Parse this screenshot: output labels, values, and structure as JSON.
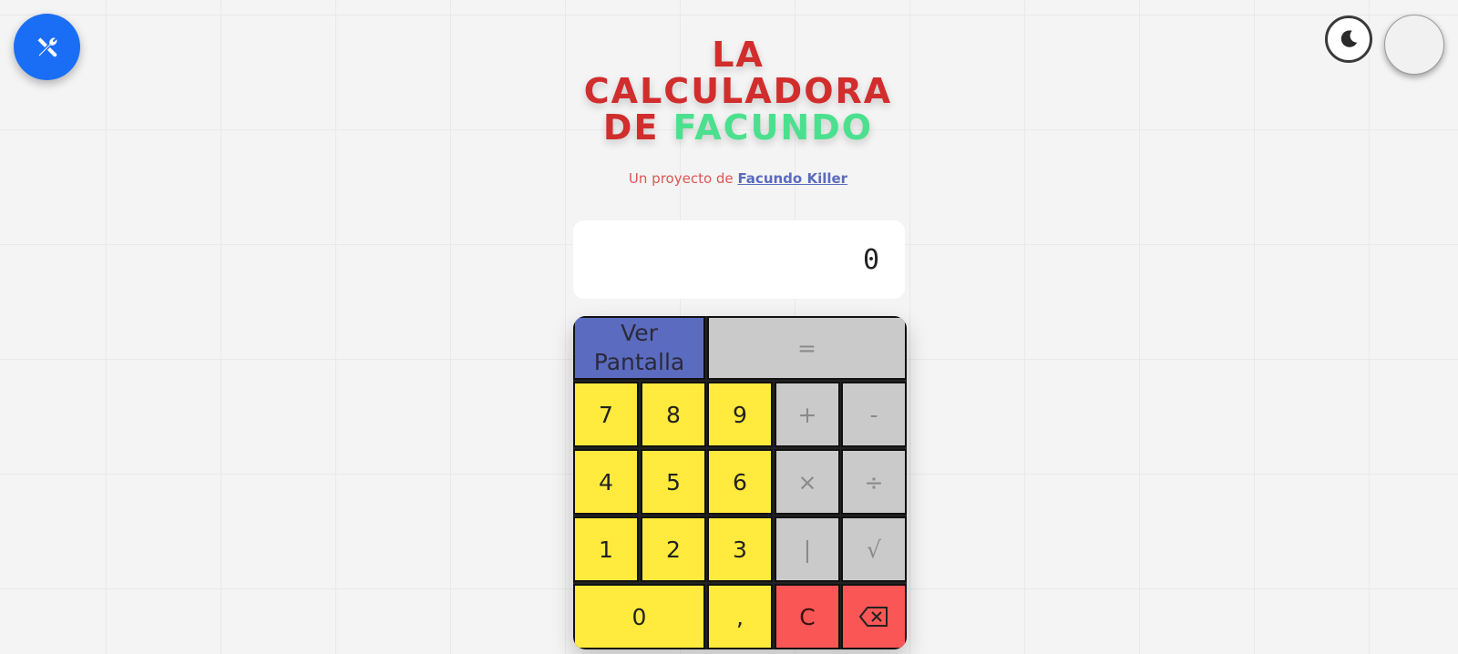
{
  "header": {
    "title_line1": "LA",
    "title_line2": "CALCULADORA",
    "title_line3_prefix": "DE",
    "title_line3_highlight": "FACUNDO",
    "subtitle_prefix": "Un proyecto de",
    "subtitle_link": "Facundo Killer"
  },
  "display": {
    "value": "0"
  },
  "keys": {
    "view_screen_1": "Ver",
    "view_screen_2": "Pantalla",
    "equals": "=",
    "seven": "7",
    "eight": "8",
    "nine": "9",
    "plus": "+",
    "minus": "-",
    "four": "4",
    "five": "5",
    "six": "6",
    "multiply": "×",
    "divide": "÷",
    "one": "1",
    "two": "2",
    "three": "3",
    "abs": "|",
    "sqrt": "√",
    "zero": "0",
    "comma": ",",
    "clear": "C",
    "backspace": "⌫"
  },
  "icons": {
    "tools": "tools-icon",
    "theme": "moon-icon"
  },
  "colors": {
    "accent_blue": "#1a6ef5",
    "title_red": "#d12d2d",
    "title_green": "#4be08e",
    "key_yellow": "#ffea3d",
    "key_gray": "#cacaca",
    "key_red": "#fb5656",
    "key_blue": "#5b6bc0"
  }
}
